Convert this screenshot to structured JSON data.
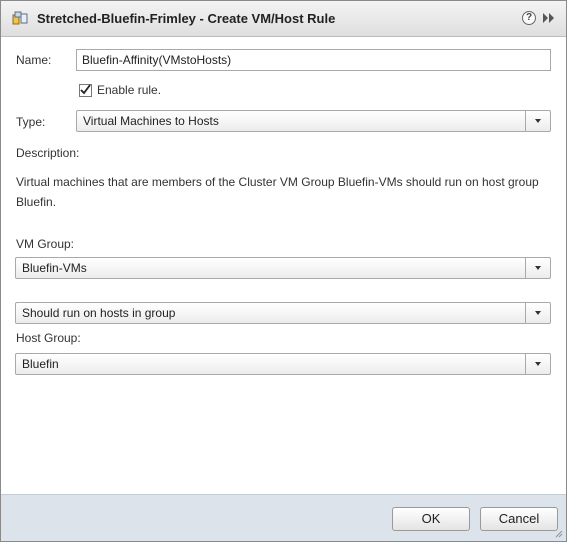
{
  "dialog": {
    "title": "Stretched-Bluefin-Frimley - Create VM/Host Rule",
    "help_glyph": "?",
    "icons": [
      "rule-icon",
      "help-icon",
      "expand-icon"
    ]
  },
  "form": {
    "name_label": "Name:",
    "name_value": "Bluefin-Affinity(VMstoHosts)",
    "enable_label": "Enable rule.",
    "enable_checked": true,
    "type_label": "Type:",
    "type_value": "Virtual Machines to Hosts",
    "description_label": "Description:",
    "description_text": "Virtual machines that are members of the Cluster VM Group Bluefin-VMs should run on host group Bluefin.",
    "vm_group_label": "VM Group:",
    "vm_group_value": "Bluefin-VMs",
    "relation_value": "Should run on hosts in group",
    "host_group_label": "Host Group:",
    "host_group_value": "Bluefin"
  },
  "footer": {
    "ok_label": "OK",
    "cancel_label": "Cancel"
  },
  "colors": {
    "footer_bg": "#dde3ea",
    "titlebar_bg": "#e6e6e6"
  }
}
